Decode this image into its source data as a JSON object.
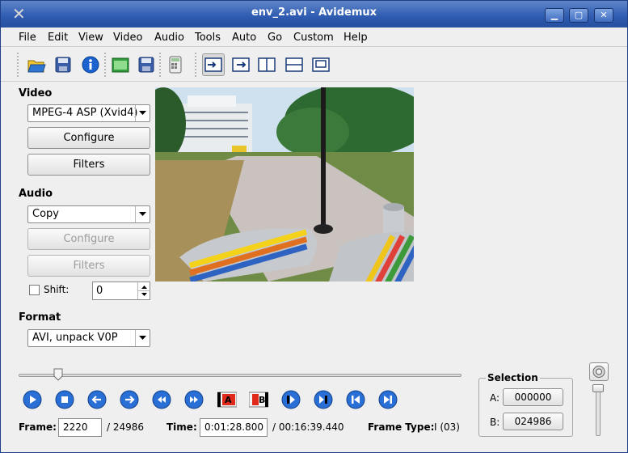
{
  "window": {
    "title": "env_2.avi - Avidemux"
  },
  "menu": [
    {
      "label": "File"
    },
    {
      "label": "Edit"
    },
    {
      "label": "View"
    },
    {
      "label": "Video"
    },
    {
      "label": "Audio"
    },
    {
      "label": "Tools"
    },
    {
      "label": "Auto"
    },
    {
      "label": "Go"
    },
    {
      "label": "Custom"
    },
    {
      "label": "Help"
    }
  ],
  "toolbar": {
    "icons": [
      "open-icon",
      "save-icon",
      "info-icon",
      "open-folder-icon",
      "save-video-icon",
      "calculator-icon",
      "input-view-icon",
      "output-view-icon",
      "side-by-side-icon",
      "top-bottom-icon",
      "preview-icon"
    ]
  },
  "video": {
    "label": "Video",
    "codec": "MPEG-4 ASP (Xvid4)",
    "configure": "Configure",
    "filters": "Filters"
  },
  "audio": {
    "label": "Audio",
    "codec": "Copy",
    "configure": "Configure",
    "filters": "Filters",
    "shift_label": "Shift:",
    "shift_value": "0"
  },
  "format": {
    "label": "Format",
    "value": "AVI, unpack V0P"
  },
  "seek": {
    "position_fraction": 0.089
  },
  "markers": {
    "a": "A",
    "b": "B"
  },
  "info": {
    "frame_label": "Frame:",
    "frame_value": "2220",
    "frame_total": "/ 24986",
    "time_label": "Time:",
    "time_value": "0:01:28.800",
    "time_total": "/ 00:16:39.440",
    "frame_type_label": "Frame Type:",
    "frame_type_value": "I (03)"
  },
  "selection": {
    "title": "Selection",
    "a_label": "A:",
    "a_value": "000000",
    "b_label": "B:",
    "b_value": "024986"
  },
  "colors": {
    "titlebar": "#2e5bb0",
    "nav_blue": "#2a6fd6",
    "marker_red": "#e0291b"
  }
}
